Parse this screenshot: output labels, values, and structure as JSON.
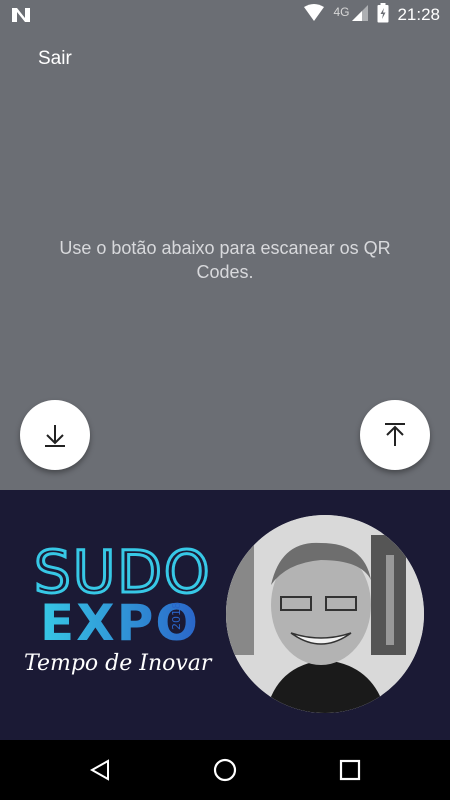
{
  "status_bar": {
    "time": "21:28",
    "network": "4G",
    "icons": [
      "n-logo-icon",
      "wifi-icon",
      "signal-icon",
      "battery-charging-icon"
    ]
  },
  "header": {
    "exit_label": "Sair"
  },
  "main": {
    "instructions": "Use o botão abaixo para escanear os QR Codes."
  },
  "fabs": {
    "left_icon": "download-arrow-icon",
    "right_icon": "upload-arrow-icon"
  },
  "banner": {
    "logo_line1": "SUDO",
    "logo_line2": "EXPO",
    "logo_year": "2018",
    "tagline": "Tempo de Inovar"
  },
  "navbar": {
    "icons": [
      "back-icon",
      "home-icon",
      "recents-icon"
    ]
  },
  "colors": {
    "background": "#6b6e74",
    "banner_bg": "#1b1a35",
    "logo_cyan": "#37c8e6",
    "logo_blue": "#2a64c8"
  }
}
